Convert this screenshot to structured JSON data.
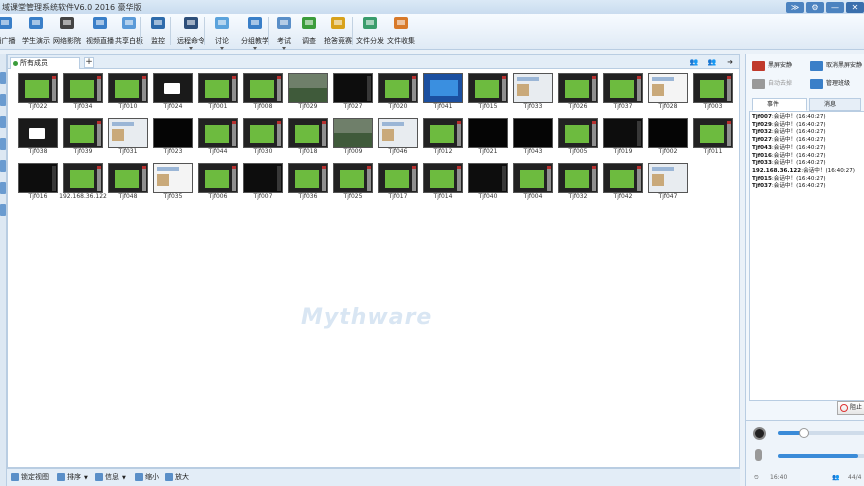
{
  "window": {
    "title": "域课堂管理系统软件V6.0 2016 豪华版",
    "buttons": [
      "≫",
      "⚙",
      "—",
      "✕"
    ]
  },
  "toolbar": {
    "items": [
      {
        "label": "播广播",
        "icon": "broadcast-icon"
      },
      {
        "label": "学生演示",
        "icon": "student-demo-icon"
      },
      {
        "label": "网络影院",
        "icon": "film-reel-icon"
      },
      {
        "label": "视频直播",
        "icon": "video-live-icon"
      },
      {
        "label": "共享白板",
        "icon": "whiteboard-icon"
      },
      {
        "label": "监控",
        "icon": "monitor-person-icon"
      },
      {
        "label": "远程命令",
        "icon": "remote-command-icon",
        "dropdown": true
      },
      {
        "label": "讨论",
        "icon": "discussion-icon",
        "dropdown": true
      },
      {
        "label": "分组教学",
        "icon": "group-teaching-icon",
        "dropdown": true
      },
      {
        "label": "考试",
        "icon": "exam-icon",
        "dropdown": true
      },
      {
        "label": "调查",
        "icon": "survey-icon"
      },
      {
        "label": "抢答竞赛",
        "icon": "quiz-star-icon"
      },
      {
        "label": "文件分发",
        "icon": "file-send-icon"
      },
      {
        "label": "文件收集",
        "icon": "file-collect-icon"
      }
    ]
  },
  "main": {
    "tab_label": "所有成员",
    "tab_add": "+",
    "watermark": "Mythware"
  },
  "students": [
    {
      "name": "Tjf022",
      "screen": "green"
    },
    {
      "name": "Tjf034",
      "screen": "green"
    },
    {
      "name": "Tjf010",
      "screen": "green"
    },
    {
      "name": "Tjf024",
      "screen": "dialog"
    },
    {
      "name": "Tjf001",
      "screen": "green"
    },
    {
      "name": "Tjf008",
      "screen": "green"
    },
    {
      "name": "Tjf029",
      "screen": "photo"
    },
    {
      "name": "Tjf027",
      "screen": "dark"
    },
    {
      "name": "Tjf020",
      "screen": "green"
    },
    {
      "name": "Tjf041",
      "screen": "blue"
    },
    {
      "name": "Tjf015",
      "screen": "green"
    },
    {
      "name": "Tjf033",
      "screen": "light"
    },
    {
      "name": "Tjf026",
      "screen": "green"
    },
    {
      "name": "Tjf037",
      "screen": "green"
    },
    {
      "name": "Tjf028",
      "screen": "white"
    },
    {
      "name": "Tjf003",
      "screen": "green"
    },
    {
      "name": "Tjf038",
      "screen": "dialog"
    },
    {
      "name": "Tjf039",
      "screen": "green"
    },
    {
      "name": "Tjf031",
      "screen": "light"
    },
    {
      "name": "Tjf023",
      "screen": "black"
    },
    {
      "name": "Tjf044",
      "screen": "green"
    },
    {
      "name": "Tjf030",
      "screen": "green"
    },
    {
      "name": "Tjf018",
      "screen": "green"
    },
    {
      "name": "Tjf009",
      "screen": "photo"
    },
    {
      "name": "Tjf046",
      "screen": "light"
    },
    {
      "name": "Tjf012",
      "screen": "green"
    },
    {
      "name": "Tjf021",
      "screen": "black"
    },
    {
      "name": "Tjf043",
      "screen": "black"
    },
    {
      "name": "Tjf005",
      "screen": "green"
    },
    {
      "name": "Tjf019",
      "screen": "dark"
    },
    {
      "name": "Tjf002",
      "screen": "black"
    },
    {
      "name": "Tjf011",
      "screen": "green"
    },
    {
      "name": "Tjf016",
      "screen": "dark"
    },
    {
      "name": "192.168.36.122",
      "screen": "green"
    },
    {
      "name": "Tjf048",
      "screen": "green"
    },
    {
      "name": "Tjf035",
      "screen": "white"
    },
    {
      "name": "Tjf006",
      "screen": "green"
    },
    {
      "name": "Tjf007",
      "screen": "dark"
    },
    {
      "name": "Tjf036",
      "screen": "green"
    },
    {
      "name": "Tjf025",
      "screen": "green"
    },
    {
      "name": "Tjf017",
      "screen": "green"
    },
    {
      "name": "Tjf014",
      "screen": "green"
    },
    {
      "name": "Tjf040",
      "screen": "dark"
    },
    {
      "name": "Tjf004",
      "screen": "green"
    },
    {
      "name": "Tjf032",
      "screen": "green"
    },
    {
      "name": "Tjf042",
      "screen": "green"
    },
    {
      "name": "Tjf047",
      "screen": "light"
    }
  ],
  "statusbar": {
    "items": [
      {
        "label": "锁定视图",
        "icon": "lock-view-icon"
      },
      {
        "label": "排序",
        "icon": "sort-icon",
        "dropdown": true
      },
      {
        "label": "信息",
        "icon": "info-icon",
        "dropdown": true
      },
      {
        "label": "缩小",
        "icon": "zoom-out-icon"
      },
      {
        "label": "放大",
        "icon": "zoom-in-icon"
      }
    ]
  },
  "right_panel": {
    "buttons": [
      {
        "label": "黑屏安静",
        "icon": "black-screen-icon",
        "enabled": true
      },
      {
        "label": "取消黑屏安静",
        "icon": "cancel-black-screen-icon",
        "enabled": true
      },
      {
        "label": "自动去掉",
        "icon": "auto-remove-icon",
        "enabled": false
      },
      {
        "label": "管理班级",
        "icon": "manage-class-icon",
        "enabled": true
      }
    ],
    "tabs": [
      {
        "label": "事件",
        "icon": "event-icon"
      },
      {
        "label": "消息",
        "icon": "message-icon"
      }
    ],
    "events": [
      {
        "who": "Tjf007",
        "text": "会话中！(16:40:27)"
      },
      {
        "who": "Tjf029",
        "text": "会话中！(16:40:27)"
      },
      {
        "who": "Tjf032",
        "text": "会话中！(16:40:27)"
      },
      {
        "who": "Tjf027",
        "text": "会话中！(16:40:27)"
      },
      {
        "who": "Tjf043",
        "text": "会话中！(16:40:27)"
      },
      {
        "who": "Tjf016",
        "text": "会话中！(16:40:27)"
      },
      {
        "who": "Tjf033",
        "text": "会话中！(16:40:27)"
      },
      {
        "who": "192.168.36.122",
        "text": "会话中！(16:40:27)"
      },
      {
        "who": "Tjf015",
        "text": "会话中！(16:40:27)"
      },
      {
        "who": "Tjf037",
        "text": "会话中！(16:40:27)"
      }
    ],
    "stop_label": "阻止",
    "volume": {
      "speaker_level": 0.3,
      "mic_level": 0.92
    },
    "time": "16:40",
    "count": "44/4"
  },
  "colors": {
    "accent": "#3a8bd8",
    "thumb_green": "#3e8a2e",
    "thumb_dark": "#0d0d0d"
  }
}
